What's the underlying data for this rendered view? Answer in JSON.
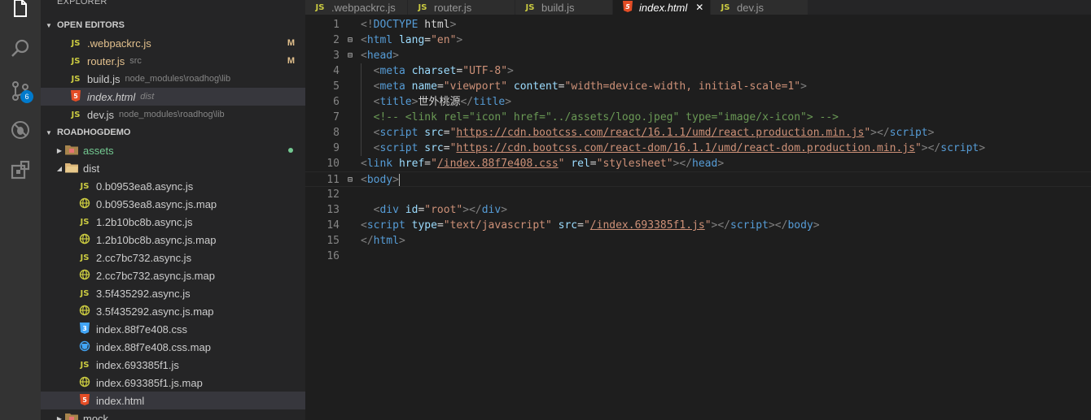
{
  "activity_bar": {
    "items": [
      {
        "name": "files-icon"
      },
      {
        "name": "search-icon"
      },
      {
        "name": "source-control-icon"
      },
      {
        "name": "debug-icon"
      },
      {
        "name": "extensions-icon"
      }
    ],
    "scm_badge": "6"
  },
  "sidebar": {
    "title": "EXPLORER",
    "open_editors_title": "OPEN EDITORS",
    "open_editors": [
      {
        "name": ".webpackrc.js",
        "desc": "",
        "status": "M",
        "icon": "js"
      },
      {
        "name": "router.js",
        "desc": "src",
        "status": "M",
        "icon": "js"
      },
      {
        "name": "build.js",
        "desc": "node_modules\\roadhog\\lib",
        "status": "",
        "icon": "js"
      },
      {
        "name": "index.html",
        "desc": "dist",
        "status": "",
        "icon": "html"
      },
      {
        "name": "dev.js",
        "desc": "node_modules\\roadhog\\lib",
        "status": "",
        "icon": "js"
      }
    ],
    "project_title": "ROADHOGDEMO",
    "tree": [
      {
        "name": "assets",
        "type": "folder-closed"
      },
      {
        "name": "dist",
        "type": "folder-open"
      },
      {
        "name": "0.b0953ea8.async.js",
        "type": "js"
      },
      {
        "name": "0.b0953ea8.async.js.map",
        "type": "map"
      },
      {
        "name": "1.2b10bc8b.async.js",
        "type": "js"
      },
      {
        "name": "1.2b10bc8b.async.js.map",
        "type": "map"
      },
      {
        "name": "2.cc7bc732.async.js",
        "type": "js"
      },
      {
        "name": "2.cc7bc732.async.js.map",
        "type": "map"
      },
      {
        "name": "3.5f435292.async.js",
        "type": "js"
      },
      {
        "name": "3.5f435292.async.js.map",
        "type": "map"
      },
      {
        "name": "index.88f7e408.css",
        "type": "css"
      },
      {
        "name": "index.88f7e408.css.map",
        "type": "cssmap"
      },
      {
        "name": "index.693385f1.js",
        "type": "js"
      },
      {
        "name": "index.693385f1.js.map",
        "type": "map"
      },
      {
        "name": "index.html",
        "type": "html"
      },
      {
        "name": "mock",
        "type": "folder-closed"
      }
    ]
  },
  "tabs": [
    {
      "label": ".webpackrc.js",
      "icon": "js",
      "active": false
    },
    {
      "label": "router.js",
      "icon": "js",
      "active": false
    },
    {
      "label": "build.js",
      "icon": "js",
      "active": false
    },
    {
      "label": "index.html",
      "icon": "html",
      "active": true
    },
    {
      "label": "dev.js",
      "icon": "js",
      "active": false
    }
  ],
  "close_glyph": "✕",
  "editor": {
    "lines": [
      [
        [
          "p",
          "<!"
        ],
        [
          "t",
          "DOCTYPE"
        ],
        [
          "x",
          " html"
        ],
        [
          "p",
          ">"
        ]
      ],
      [
        [
          "p",
          "<"
        ],
        [
          "t",
          "html"
        ],
        [
          "x",
          " "
        ],
        [
          "a",
          "lang"
        ],
        [
          "x",
          "="
        ],
        [
          "s",
          "\"en\""
        ],
        [
          "p",
          ">"
        ]
      ],
      [
        [
          "p",
          "<"
        ],
        [
          "t",
          "head"
        ],
        [
          "p",
          ">"
        ]
      ],
      [
        [
          "x",
          "  "
        ],
        [
          "p",
          "<"
        ],
        [
          "t",
          "meta"
        ],
        [
          "x",
          " "
        ],
        [
          "a",
          "charset"
        ],
        [
          "x",
          "="
        ],
        [
          "s",
          "\"UTF-8\""
        ],
        [
          "p",
          ">"
        ]
      ],
      [
        [
          "x",
          "  "
        ],
        [
          "p",
          "<"
        ],
        [
          "t",
          "meta"
        ],
        [
          "x",
          " "
        ],
        [
          "a",
          "name"
        ],
        [
          "x",
          "="
        ],
        [
          "s",
          "\"viewport\""
        ],
        [
          "x",
          " "
        ],
        [
          "a",
          "content"
        ],
        [
          "x",
          "="
        ],
        [
          "s",
          "\"width=device-width, initial-scale=1\""
        ],
        [
          "p",
          ">"
        ]
      ],
      [
        [
          "x",
          "  "
        ],
        [
          "p",
          "<"
        ],
        [
          "t",
          "title"
        ],
        [
          "p",
          ">"
        ],
        [
          "x",
          "世外桃源"
        ],
        [
          "p",
          "</"
        ],
        [
          "t",
          "title"
        ],
        [
          "p",
          ">"
        ]
      ],
      [
        [
          "x",
          "  "
        ],
        [
          "c",
          "<!-- <link rel=\"icon\" href=\"../assets/logo.jpeg\" type=\"image/x-icon\"> -->"
        ]
      ],
      [
        [
          "x",
          "  "
        ],
        [
          "p",
          "<"
        ],
        [
          "t",
          "script"
        ],
        [
          "x",
          " "
        ],
        [
          "a",
          "src"
        ],
        [
          "x",
          "="
        ],
        [
          "s",
          "\""
        ],
        [
          "u",
          "https://cdn.bootcss.com/react/16.1.1/umd/react.production.min.js"
        ],
        [
          "s",
          "\""
        ],
        [
          "p",
          ">"
        ],
        [
          "p",
          "</"
        ],
        [
          "t",
          "script"
        ],
        [
          "p",
          ">"
        ]
      ],
      [
        [
          "x",
          "  "
        ],
        [
          "p",
          "<"
        ],
        [
          "t",
          "script"
        ],
        [
          "x",
          " "
        ],
        [
          "a",
          "src"
        ],
        [
          "x",
          "="
        ],
        [
          "s",
          "\""
        ],
        [
          "u",
          "https://cdn.bootcss.com/react-dom/16.1.1/umd/react-dom.production.min.js"
        ],
        [
          "s",
          "\""
        ],
        [
          "p",
          ">"
        ],
        [
          "p",
          "</"
        ],
        [
          "t",
          "script"
        ],
        [
          "p",
          ">"
        ]
      ],
      [
        [
          "p",
          "<"
        ],
        [
          "t",
          "link"
        ],
        [
          "x",
          " "
        ],
        [
          "a",
          "href"
        ],
        [
          "x",
          "="
        ],
        [
          "s",
          "\""
        ],
        [
          "u",
          "/index.88f7e408.css"
        ],
        [
          "s",
          "\""
        ],
        [
          "x",
          " "
        ],
        [
          "a",
          "rel"
        ],
        [
          "x",
          "="
        ],
        [
          "s",
          "\"stylesheet\""
        ],
        [
          "p",
          ">"
        ],
        [
          "p",
          "</"
        ],
        [
          "t",
          "head"
        ],
        [
          "p",
          ">"
        ]
      ],
      [
        [
          "p",
          "<"
        ],
        [
          "t",
          "body"
        ],
        [
          "p",
          ">"
        ]
      ],
      [],
      [
        [
          "x",
          "  "
        ],
        [
          "p",
          "<"
        ],
        [
          "t",
          "div"
        ],
        [
          "x",
          " "
        ],
        [
          "a",
          "id"
        ],
        [
          "x",
          "="
        ],
        [
          "s",
          "\"root\""
        ],
        [
          "p",
          ">"
        ],
        [
          "p",
          "</"
        ],
        [
          "t",
          "div"
        ],
        [
          "p",
          ">"
        ]
      ],
      [
        [
          "p",
          "<"
        ],
        [
          "t",
          "script"
        ],
        [
          "x",
          " "
        ],
        [
          "a",
          "type"
        ],
        [
          "x",
          "="
        ],
        [
          "s",
          "\"text/javascript\""
        ],
        [
          "x",
          " "
        ],
        [
          "a",
          "src"
        ],
        [
          "x",
          "="
        ],
        [
          "s",
          "\""
        ],
        [
          "u",
          "/index.693385f1.js"
        ],
        [
          "s",
          "\""
        ],
        [
          "p",
          ">"
        ],
        [
          "p",
          "</"
        ],
        [
          "t",
          "script"
        ],
        [
          "p",
          ">"
        ],
        [
          "p",
          "</"
        ],
        [
          "t",
          "body"
        ],
        [
          "p",
          ">"
        ]
      ],
      [
        [
          "p",
          "</"
        ],
        [
          "t",
          "html"
        ],
        [
          "p",
          ">"
        ]
      ],
      []
    ]
  }
}
